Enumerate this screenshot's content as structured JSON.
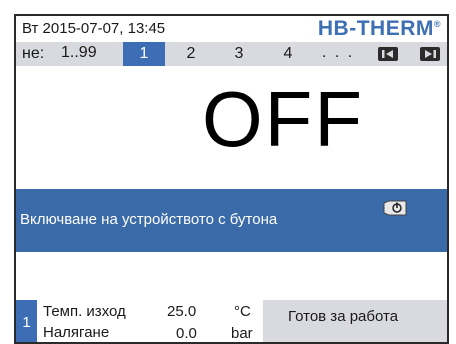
{
  "status_bar": {
    "datetime": "Вт  2015-07-07, 13:45",
    "logo": "HB-THERM",
    "logo_mark": "®"
  },
  "unit_nav": {
    "label": "не:",
    "range": "1..99",
    "slots": [
      "1",
      "2",
      "3",
      "4"
    ],
    "active_slot": "1",
    "ellipsis": ". . .",
    "prev_icon": "first-page-icon",
    "next_icon": "last-page-icon"
  },
  "main": {
    "state_text": "OFF",
    "info_message": "Включване на устройството с бутона",
    "info_icon": "power-button-icon"
  },
  "footer": {
    "unit_index": "1",
    "rows": [
      {
        "label": "Темп. изход",
        "value": "25.0",
        "unit": "°C"
      },
      {
        "label": "Налягане",
        "value": "0.0",
        "unit": "bar"
      }
    ],
    "status": "Готов за работа"
  },
  "colors": {
    "accent_blue": "#3d6db5",
    "info_blue": "#3a6aa8",
    "nav_gray": "#d9dadf",
    "logo_blue": "#3d6fb3"
  }
}
